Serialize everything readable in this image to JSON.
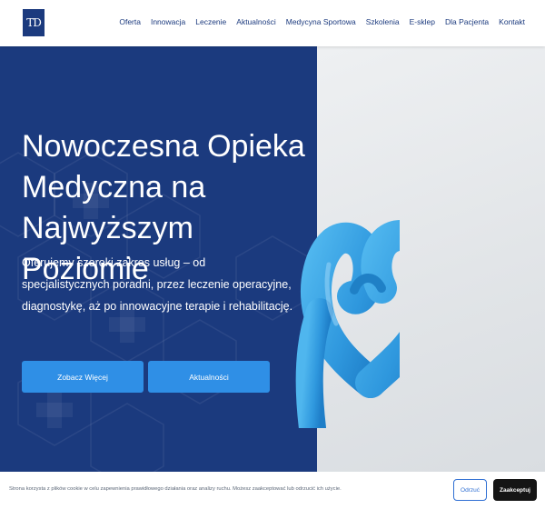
{
  "header": {
    "logo_text": "TD",
    "nav": [
      {
        "label": "Oferta"
      },
      {
        "label": "Innowacja"
      },
      {
        "label": "Leczenie"
      },
      {
        "label": "Aktualności"
      },
      {
        "label": "Medycyna Sportowa"
      },
      {
        "label": "Szkolenia"
      },
      {
        "label": "E-sklep"
      },
      {
        "label": "Dla Pacjenta"
      },
      {
        "label": "Kontakt"
      }
    ]
  },
  "hero": {
    "title_lines": [
      "Nowoczesna Opieka",
      "Medyczna na Najwyższym",
      "Poziomie"
    ],
    "description": "Oferujemy szeroki zakres usług – od specjalistycznych poradni, przez leczenie operacyjne, diagnostykę, aż po innowacyjne terapie i rehabilitację.",
    "buttons": {
      "more": "Zobacz Więcej",
      "news": "Aktualności"
    }
  },
  "cookie_bar": {
    "text": "Strona korzysta z plików cookie w celu zapewnienia prawidłowego działania oraz analizy ruchu. Możesz zaakceptować lub odrzucić ich użycie.",
    "reject_label": "Odrzuć",
    "accept_label": "Zaakceptuj"
  },
  "colors": {
    "brand": "#1b3a7e",
    "button": "#2f8fe6",
    "glove": "#3aa6e6",
    "accept_bg": "#151515"
  },
  "icons": [
    "medical-hexagon-pattern",
    "heart-hands-image"
  ]
}
